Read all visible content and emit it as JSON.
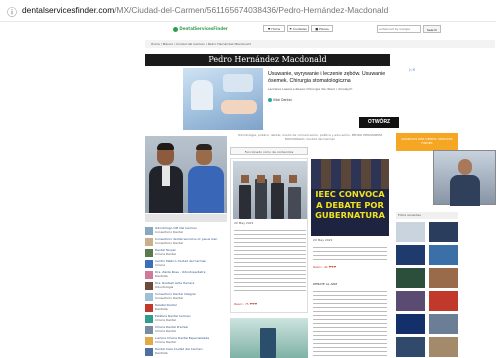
{
  "browser": {
    "url_secure": "ⓘ",
    "url_domain": "dentalservicesfinder.com",
    "url_path": "/MX/Ciudad-del-Carmen/561165674038436/Pedro-Hernández-Macdonald"
  },
  "site": {
    "logo": "DentalServicesFinder",
    "nav": [
      "♥ Home",
      "⚑ Ciudades",
      "■ Places"
    ],
    "search_placeholder": "enhanced by Google",
    "search_button": "Search",
    "breadcrumb": "Home / México / Ciudad del Carmen / Pedro Hernández Macdonald"
  },
  "profile": {
    "name": "Pedro Hernández Macdonald",
    "page_caption": "Odontología, público, dental, medio de comunicación, política y educación, PEDRO HERNÁNDEZ MACDONALD, Ciudad del Carmen",
    "tab_label": "Funcionado como de contenidos"
  },
  "ad": {
    "title": "Usuwanie, wyrywanie i leczenie zębów. Usuwanie ósemek. Chirurgia stomatologiczna",
    "subtitle": "Leczenie Lasera Lubiewo Chirurgia dla dzieci i dorosłych",
    "brand": "Vital Dental",
    "button": "OTWÓRZ"
  },
  "post": {
    "date": "20 May 2021",
    "reactions": "Reacc. 75 ❤❤❤",
    "headline": "IEEC CONVOCA A DEBATE POR GUBERNATURA",
    "headline_lines": [
      "IEEC CONVOCA",
      "A DEBATE POR",
      "GUBERNATURA"
    ],
    "side_date": "20 May 2021",
    "side_heading": "DEBATE AL AIRE",
    "side_reactions": "Reacc. 42 ❤❤❤"
  },
  "right_panel": {
    "badge_text": "ANUNCIOS POR DENTAL SERVICES FINDER",
    "header": "Fotos recientes"
  },
  "sidebar": {
    "items": [
      {
        "name": "Odontólogo CIE Del Carmen",
        "sub": "Consultorio Dental"
      },
      {
        "name": "Consultorio dental servicios dr. Jesus Ivan",
        "sub": "Consultorio Dental"
      },
      {
        "name": "Dental Tecpac",
        "sub": "Clínica Dental"
      },
      {
        "name": "Centro Médico Ciudad del Carmen",
        "sub": "Clínica"
      },
      {
        "name": "Dra. Zaida Rosa - Odontopediatra",
        "sub": "Dentista"
      },
      {
        "name": "Dra. Rosibell Avila Herrera",
        "sub": "Odontología"
      },
      {
        "name": "Consultorio Dental Integral",
        "sub": "Consultorio Dental"
      },
      {
        "name": "Delatal Dental",
        "sub": "Dentista"
      },
      {
        "name": "Estética Dental Carmen",
        "sub": "Clínica Dental"
      },
      {
        "name": "Clínica Dental Premier",
        "sub": "Clínica Dental"
      },
      {
        "name": "Lumina Clínica Dental Especializada",
        "sub": "Clínica Dental"
      },
      {
        "name": "Dental Care Ciudad del Carmen",
        "sub": "Dentista"
      }
    ]
  },
  "colors": {
    "name_bar": "#1a1a1a",
    "ad_button": "#111111",
    "right_badge": "#f5a623",
    "post_bg": "#1e2340",
    "headline_color": "#f0e21c"
  }
}
